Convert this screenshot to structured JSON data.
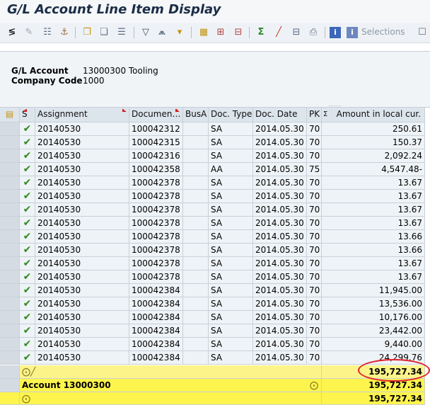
{
  "title": "G/L Account Line Item Display",
  "toolbar": {
    "selections_label": "Selections"
  },
  "header": {
    "gl_account_label": "G/L Account",
    "gl_account_value": "13000300 Tooling",
    "company_code_label": "Company Code",
    "company_code_value": "1000"
  },
  "table": {
    "columns": [
      "S",
      "Assignment",
      "Documen…",
      "BusA",
      "Doc. Type",
      "Doc. Date",
      "PK",
      "Amount in local cur."
    ],
    "rows": [
      [
        "20140530",
        "100042312",
        "",
        "SA",
        "2014.05.30",
        "70",
        "250.61"
      ],
      [
        "20140530",
        "100042315",
        "",
        "SA",
        "2014.05.30",
        "70",
        "150.37"
      ],
      [
        "20140530",
        "100042316",
        "",
        "SA",
        "2014.05.30",
        "70",
        "2,092.24"
      ],
      [
        "20140530",
        "100042358",
        "",
        "AA",
        "2014.05.30",
        "75",
        "4,547.48-"
      ],
      [
        "20140530",
        "100042378",
        "",
        "SA",
        "2014.05.30",
        "70",
        "13.67"
      ],
      [
        "20140530",
        "100042378",
        "",
        "SA",
        "2014.05.30",
        "70",
        "13.67"
      ],
      [
        "20140530",
        "100042378",
        "",
        "SA",
        "2014.05.30",
        "70",
        "13.67"
      ],
      [
        "20140530",
        "100042378",
        "",
        "SA",
        "2014.05.30",
        "70",
        "13.67"
      ],
      [
        "20140530",
        "100042378",
        "",
        "SA",
        "2014.05.30",
        "70",
        "13.66"
      ],
      [
        "20140530",
        "100042378",
        "",
        "SA",
        "2014.05.30",
        "70",
        "13.66"
      ],
      [
        "20140530",
        "100042378",
        "",
        "SA",
        "2014.05.30",
        "70",
        "13.67"
      ],
      [
        "20140530",
        "100042378",
        "",
        "SA",
        "2014.05.30",
        "70",
        "13.67"
      ],
      [
        "20140530",
        "100042384",
        "",
        "SA",
        "2014.05.30",
        "70",
        "11,945.00"
      ],
      [
        "20140530",
        "100042384",
        "",
        "SA",
        "2014.05.30",
        "70",
        "13,536.00"
      ],
      [
        "20140530",
        "100042384",
        "",
        "SA",
        "2014.05.30",
        "70",
        "10,176.00"
      ],
      [
        "20140530",
        "100042384",
        "",
        "SA",
        "2014.05.30",
        "70",
        "23,442.00"
      ],
      [
        "20140530",
        "100042384",
        "",
        "SA",
        "2014.05.30",
        "70",
        "9,440.00"
      ],
      [
        "20140530",
        "100042384",
        "",
        "SA",
        "2014.05.30",
        "70",
        "24,299.76"
      ]
    ],
    "subtotal_amount": "195,727.34",
    "account_total_label": "Account 13000300",
    "account_total_amount": "195,727.34",
    "grand_total_amount": "195,727.34"
  },
  "colors": {
    "highlight_yellow": "#fcf489",
    "total_yellow": "#fdf44d",
    "check_green": "#2f8a1a",
    "annotation_red": "#e0202a"
  }
}
